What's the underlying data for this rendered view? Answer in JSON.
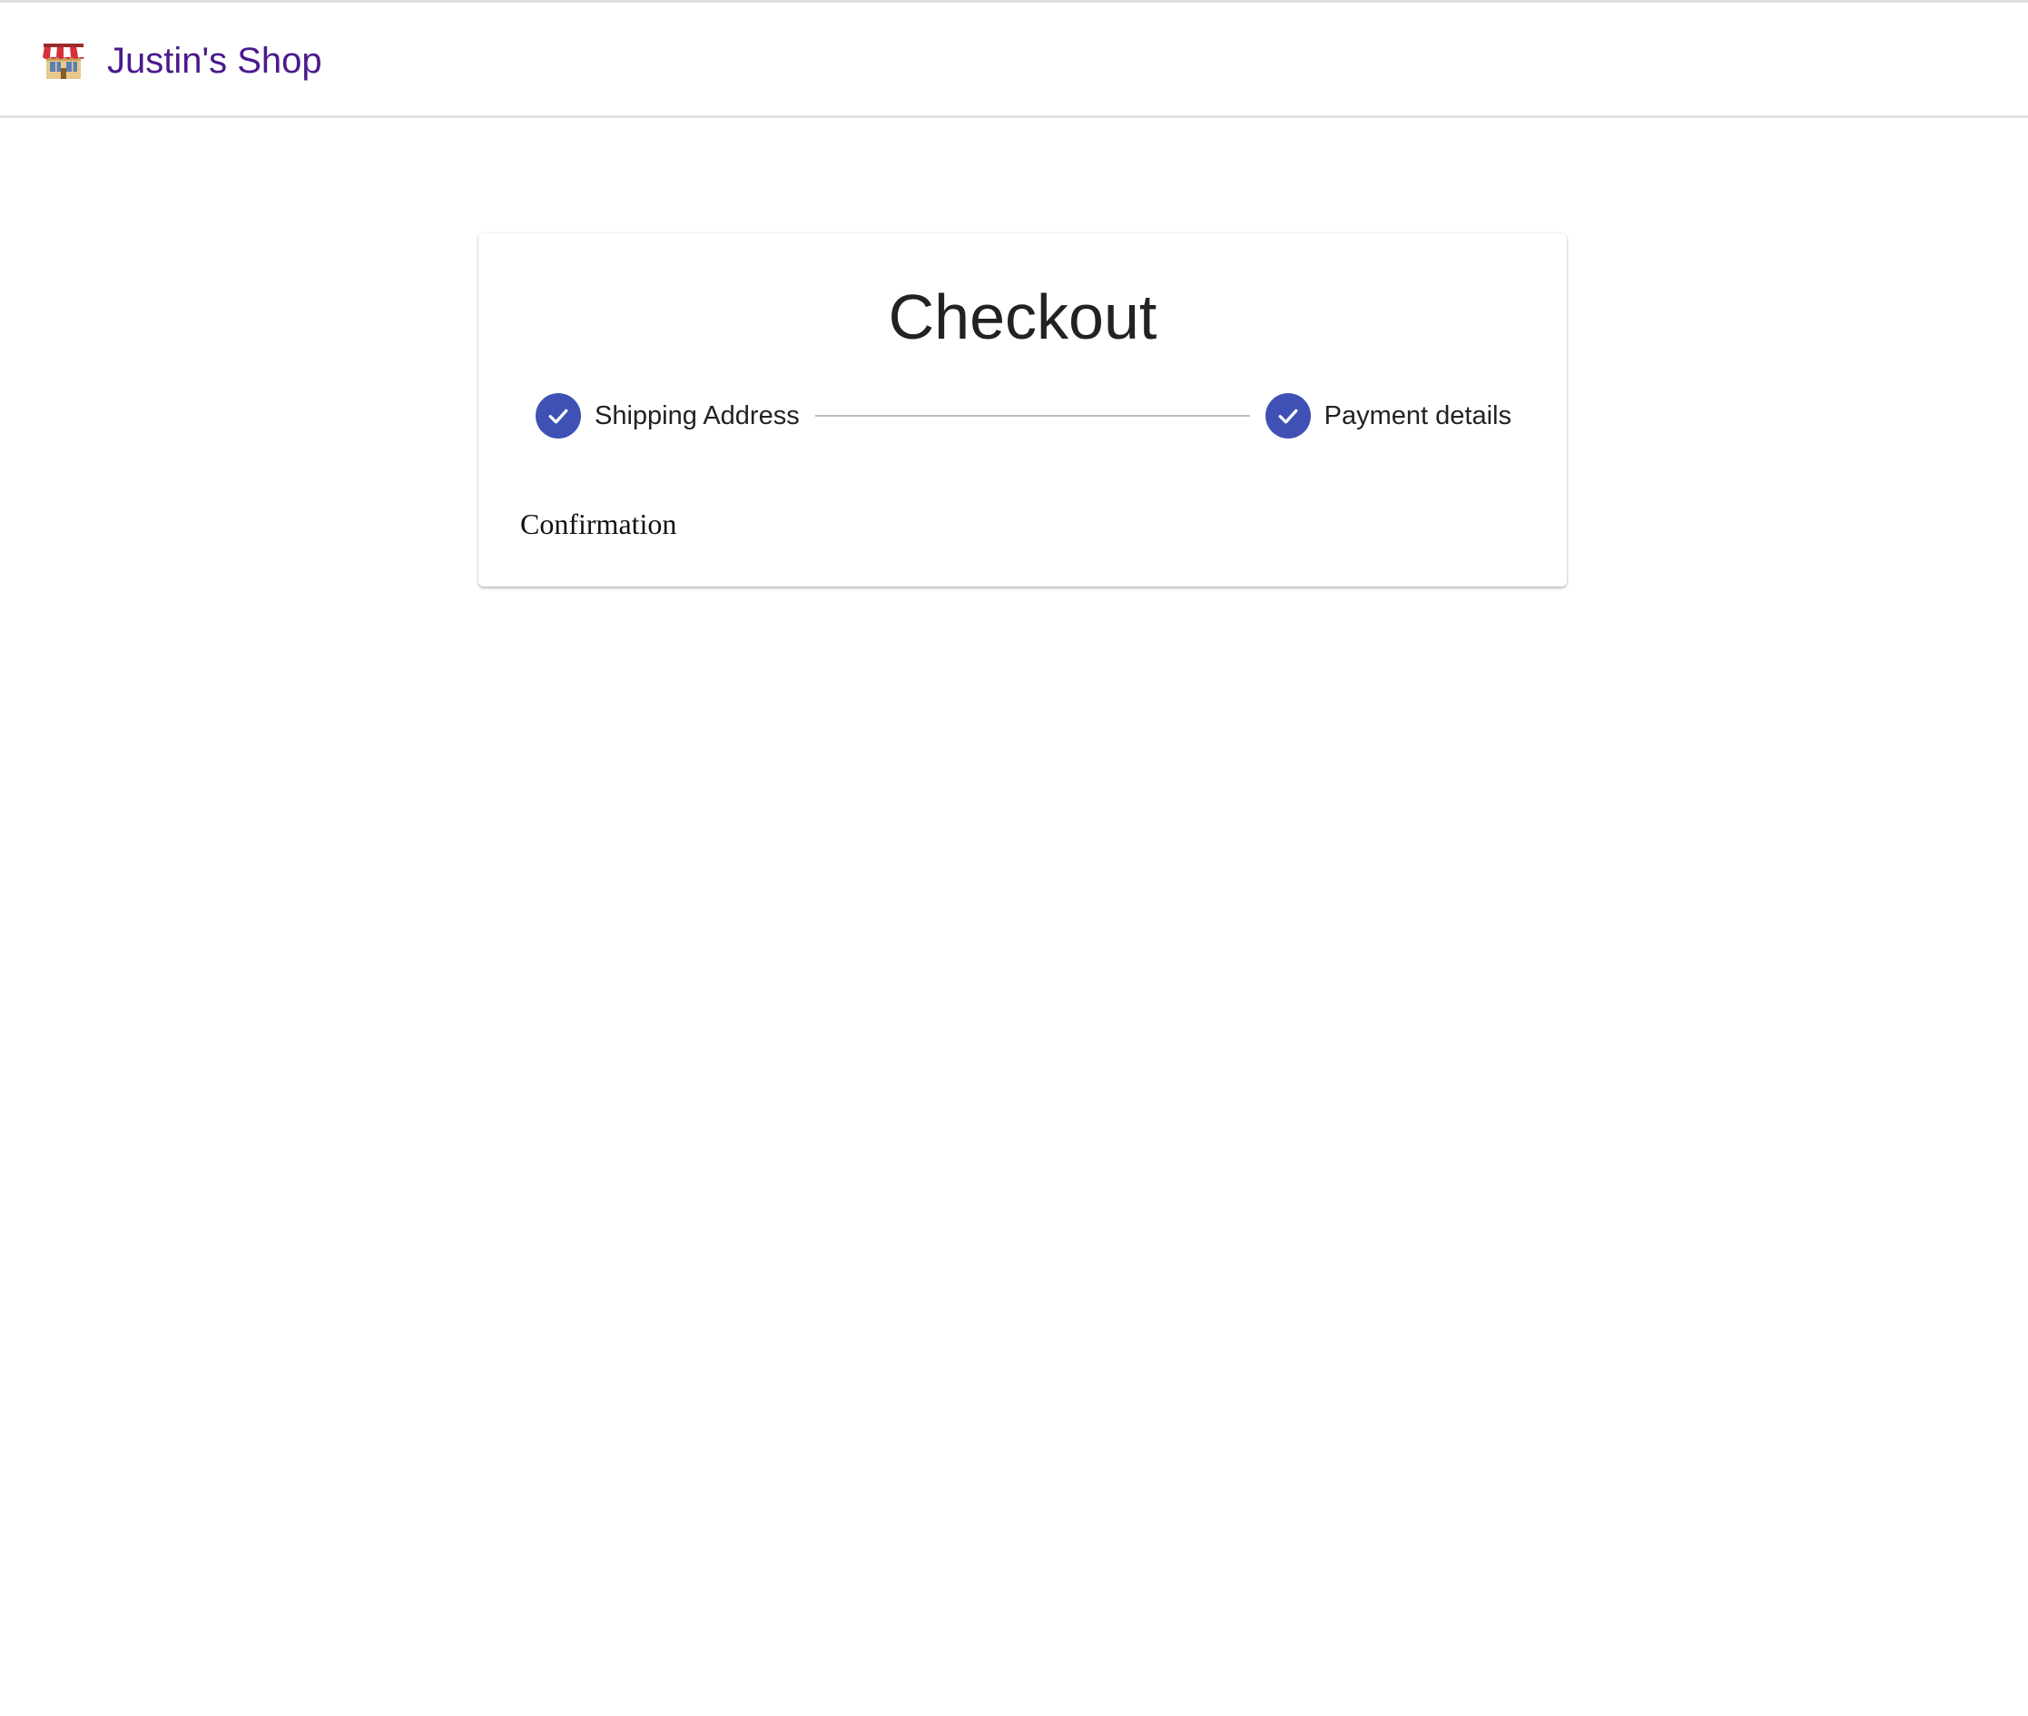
{
  "header": {
    "brand_name": "Justin's Shop",
    "icon": "store-icon",
    "brand_color": "#4a1a8c"
  },
  "checkout": {
    "title": "Checkout",
    "steps": [
      {
        "label": "Shipping Address",
        "status": "completed",
        "icon": "check-icon"
      },
      {
        "label": "Payment details",
        "status": "completed",
        "icon": "check-icon"
      }
    ],
    "step_color": "#3f51b5",
    "content_text": "Confirmation"
  }
}
